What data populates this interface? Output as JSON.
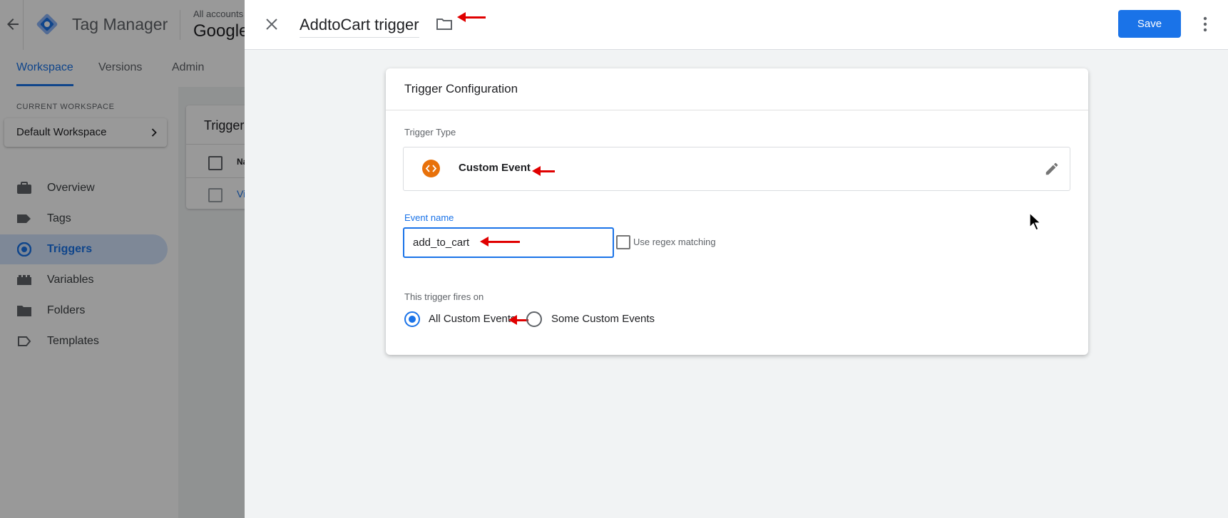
{
  "app": {
    "back_icon": "arrow-left-icon",
    "logo_icon": "gtm-diamond-icon",
    "name": "Tag Manager",
    "account_label": "All accounts",
    "account_name": "Google"
  },
  "nav": {
    "tabs": [
      {
        "label": "Workspace",
        "active": true
      },
      {
        "label": "Versions",
        "active": false
      },
      {
        "label": "Admin",
        "active": false
      }
    ]
  },
  "sidebar": {
    "current_workspace_label": "CURRENT WORKSPACE",
    "workspace_name": "Default Workspace",
    "items": [
      {
        "label": "Overview",
        "icon": "briefcase-icon",
        "active": false
      },
      {
        "label": "Tags",
        "icon": "tag-icon",
        "active": false
      },
      {
        "label": "Triggers",
        "icon": "trigger-icon",
        "active": true
      },
      {
        "label": "Variables",
        "icon": "variables-icon",
        "active": false
      },
      {
        "label": "Folders",
        "icon": "folder-icon",
        "active": false
      },
      {
        "label": "Templates",
        "icon": "template-icon",
        "active": false
      }
    ]
  },
  "background_list": {
    "title": "Trigger",
    "col_name": "Nar",
    "row_link": "Vie"
  },
  "panel": {
    "title": "AddtoCart trigger",
    "save_label": "Save",
    "close_icon": "close-icon",
    "folder_icon": "folder-outline-icon",
    "more_icon": "more-vert-icon"
  },
  "card": {
    "title": "Trigger Configuration",
    "trigger_type_label": "Trigger Type",
    "trigger_type_value": "Custom Event",
    "trigger_type_icon": "code-icon",
    "edit_icon": "pencil-icon",
    "event_name_label": "Event name",
    "event_name_value": "add_to_cart",
    "regex_label": "Use regex matching",
    "fires_on_label": "This trigger fires on",
    "options": [
      {
        "label": "All Custom Events",
        "selected": true
      },
      {
        "label": "Some Custom Events",
        "selected": false
      }
    ]
  },
  "colors": {
    "accent": "#1a73e8",
    "trigger_icon_bg": "#e8710a",
    "annotation_arrow": "#e00000"
  }
}
